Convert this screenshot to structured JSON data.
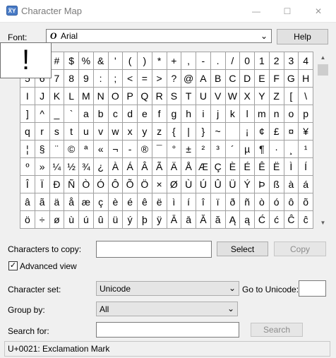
{
  "window": {
    "title": "Character Map",
    "minimize_glyph": "—",
    "maximize_glyph": "☐",
    "close_glyph": "✕"
  },
  "font": {
    "label": "Font:",
    "glyph": "O",
    "value": "Arial",
    "dropdown_glyph": "⌄"
  },
  "help_label": "Help",
  "zoomed_char": "!",
  "grid_rows": [
    [
      "!",
      "\"",
      "#",
      "$",
      "%",
      "&",
      "'",
      "(",
      ")",
      "*",
      "+",
      ",",
      "-",
      ".",
      "/",
      "0",
      "1",
      "2",
      "3",
      "4"
    ],
    [
      "5",
      "6",
      "7",
      "8",
      "9",
      ":",
      ";",
      "<",
      "=",
      ">",
      "?",
      "@",
      "A",
      "B",
      "C",
      "D",
      "E",
      "F",
      "G",
      "H"
    ],
    [
      "I",
      "J",
      "K",
      "L",
      "M",
      "N",
      "O",
      "P",
      "Q",
      "R",
      "S",
      "T",
      "U",
      "V",
      "W",
      "X",
      "Y",
      "Z",
      "[",
      "\\"
    ],
    [
      "]",
      "^",
      "_",
      "`",
      "a",
      "b",
      "c",
      "d",
      "e",
      "f",
      "g",
      "h",
      "i",
      "j",
      "k",
      "l",
      "m",
      "n",
      "o",
      "p"
    ],
    [
      "q",
      "r",
      "s",
      "t",
      "u",
      "v",
      "w",
      "x",
      "y",
      "z",
      "{",
      "|",
      "}",
      "~",
      "",
      "¡",
      "¢",
      "£",
      "¤",
      "¥"
    ],
    [
      "¦",
      "§",
      "¨",
      "©",
      "ª",
      "«",
      "¬",
      "-",
      "®",
      "¯",
      "°",
      "±",
      "²",
      "³",
      "´",
      "µ",
      "¶",
      "·",
      "¸",
      "¹"
    ],
    [
      "º",
      "»",
      "¼",
      "½",
      "¾",
      "¿",
      "À",
      "Á",
      "Â",
      "Ã",
      "Ä",
      "Å",
      "Æ",
      "Ç",
      "È",
      "É",
      "Ê",
      "Ë",
      "Ì",
      "Í"
    ],
    [
      "Î",
      "Ï",
      "Ð",
      "Ñ",
      "Ò",
      "Ó",
      "Ô",
      "Õ",
      "Ö",
      "×",
      "Ø",
      "Ù",
      "Ú",
      "Û",
      "Ü",
      "Ý",
      "Þ",
      "ß",
      "à",
      "á"
    ],
    [
      "â",
      "ã",
      "ä",
      "å",
      "æ",
      "ç",
      "è",
      "é",
      "ê",
      "ë",
      "ì",
      "í",
      "î",
      "ï",
      "ð",
      "ñ",
      "ò",
      "ó",
      "ô",
      "õ"
    ],
    [
      "ö",
      "÷",
      "ø",
      "ù",
      "ú",
      "û",
      "ü",
      "ý",
      "þ",
      "ÿ",
      "Ā",
      "ā",
      "Ă",
      "ă",
      "Ą",
      "ą",
      "Ć",
      "ć",
      "Ĉ",
      "ĉ"
    ]
  ],
  "scrollbar": {
    "up_glyph": "▲",
    "down_glyph": "▼"
  },
  "copy": {
    "label": "Characters to copy:",
    "value": "",
    "select_label": "Select",
    "copy_label": "Copy"
  },
  "advanced": {
    "label": "Advanced view",
    "checked_glyph": "✓"
  },
  "charset": {
    "label": "Character set:",
    "value": "Unicode",
    "dropdown_glyph": "⌄"
  },
  "goto": {
    "label": "Go to Unicode:",
    "value": ""
  },
  "groupby": {
    "label": "Group by:",
    "value": "All",
    "dropdown_glyph": "⌄"
  },
  "search": {
    "label": "Search for:",
    "value": "",
    "button_label": "Search"
  },
  "status": "U+0021: Exclamation Mark"
}
